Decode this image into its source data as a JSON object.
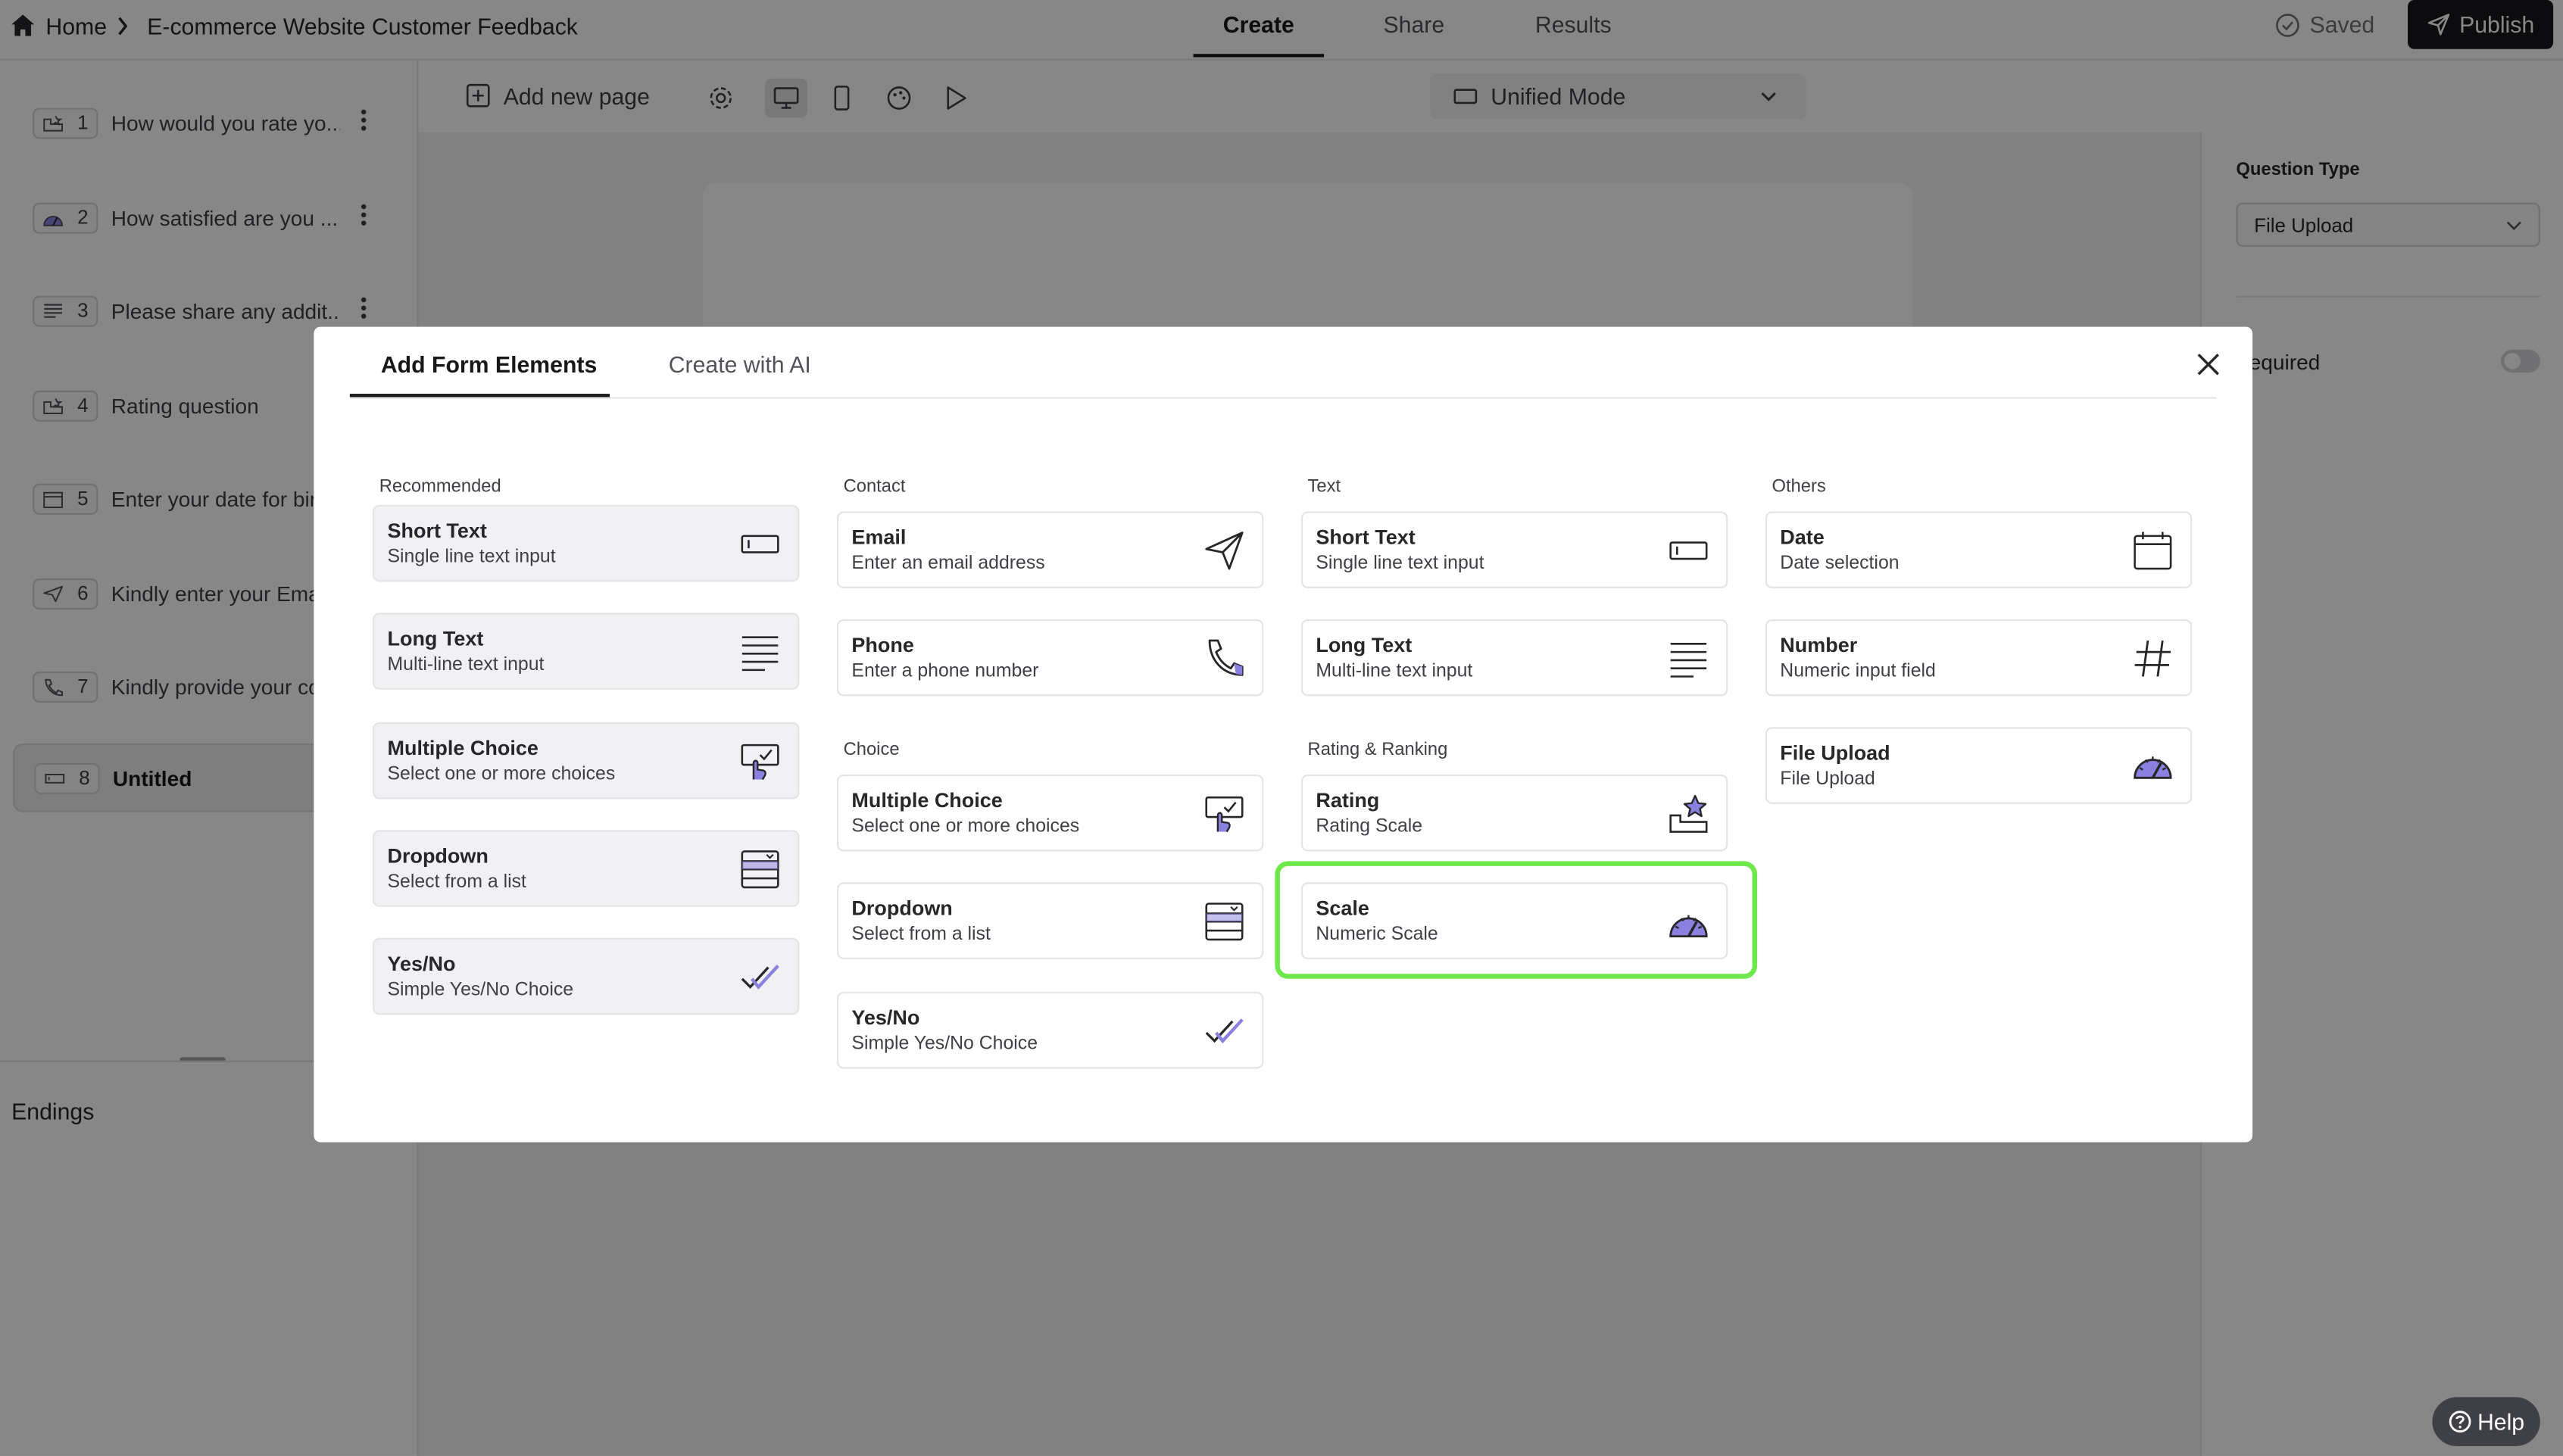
{
  "topbar": {
    "home": "Home",
    "breadcrumb_title": "E-commerce Website Customer Feedback",
    "tabs": [
      "Create",
      "Share",
      "Results"
    ],
    "saved": "Saved",
    "publish": "Publish"
  },
  "sidebar": {
    "questions": [
      {
        "num": "1",
        "label": "How would you rate yo..."
      },
      {
        "num": "2",
        "label": "How satisfied are you ..."
      },
      {
        "num": "3",
        "label": "Please share any addit..."
      },
      {
        "num": "4",
        "label": "Rating question"
      },
      {
        "num": "5",
        "label": "Enter your date for bir"
      },
      {
        "num": "6",
        "label": "Kindly enter your Ema"
      },
      {
        "num": "7",
        "label": "Kindly provide your co"
      },
      {
        "num": "8",
        "label": "Untitled"
      }
    ],
    "endings": "Endings"
  },
  "toolbar": {
    "add_page": "Add new page",
    "mode": "Unified Mode"
  },
  "right_panel": {
    "question_type_label": "Question Type",
    "question_type_value": "File Upload",
    "required_label": "equired"
  },
  "modal": {
    "tabs": [
      "Add Form Elements",
      "Create with AI"
    ],
    "columns": {
      "recommended": {
        "heading": "Recommended",
        "items": [
          {
            "title": "Short Text",
            "sub": "Single line text input",
            "icon": "short-text-icon"
          },
          {
            "title": "Long Text",
            "sub": "Multi-line text input",
            "icon": "long-text-icon"
          },
          {
            "title": "Multiple Choice",
            "sub": "Select one or more choices",
            "icon": "multiple-choice-icon"
          },
          {
            "title": "Dropdown",
            "sub": "Select from a list",
            "icon": "dropdown-icon"
          },
          {
            "title": "Yes/No",
            "sub": "Simple Yes/No Choice",
            "icon": "yes-no-icon"
          }
        ]
      },
      "contact": {
        "heading": "Contact",
        "items": [
          {
            "title": "Email",
            "sub": "Enter an email address",
            "icon": "paper-plane-icon"
          },
          {
            "title": "Phone",
            "sub": "Enter a phone number",
            "icon": "phone-icon"
          }
        ]
      },
      "choice": {
        "heading": "Choice",
        "items": [
          {
            "title": "Multiple Choice",
            "sub": "Select one or more choices",
            "icon": "multiple-choice-icon"
          },
          {
            "title": "Dropdown",
            "sub": "Select from a list",
            "icon": "dropdown-icon"
          },
          {
            "title": "Yes/No",
            "sub": "Simple Yes/No Choice",
            "icon": "yes-no-icon"
          }
        ]
      },
      "text": {
        "heading": "Text",
        "items": [
          {
            "title": "Short Text",
            "sub": "Single line text input",
            "icon": "short-text-icon"
          },
          {
            "title": "Long Text",
            "sub": "Multi-line text input",
            "icon": "long-text-icon"
          }
        ]
      },
      "rating": {
        "heading": "Rating & Ranking",
        "items": [
          {
            "title": "Rating",
            "sub": "Rating Scale",
            "icon": "rating-icon"
          },
          {
            "title": "Scale",
            "sub": "Numeric Scale",
            "icon": "gauge-icon"
          }
        ]
      },
      "others": {
        "heading": "Others",
        "items": [
          {
            "title": "Date",
            "sub": "Date selection",
            "icon": "calendar-icon"
          },
          {
            "title": "Number",
            "sub": "Numeric input field",
            "icon": "hash-icon"
          },
          {
            "title": "File Upload",
            "sub": "File Upload",
            "icon": "gauge-icon"
          }
        ]
      }
    }
  },
  "help": "Help",
  "colors": {
    "highlight": "#6ee84a",
    "accent_purple": "#8b7fe0",
    "overlay": "rgba(0,0,0,0.47)"
  }
}
